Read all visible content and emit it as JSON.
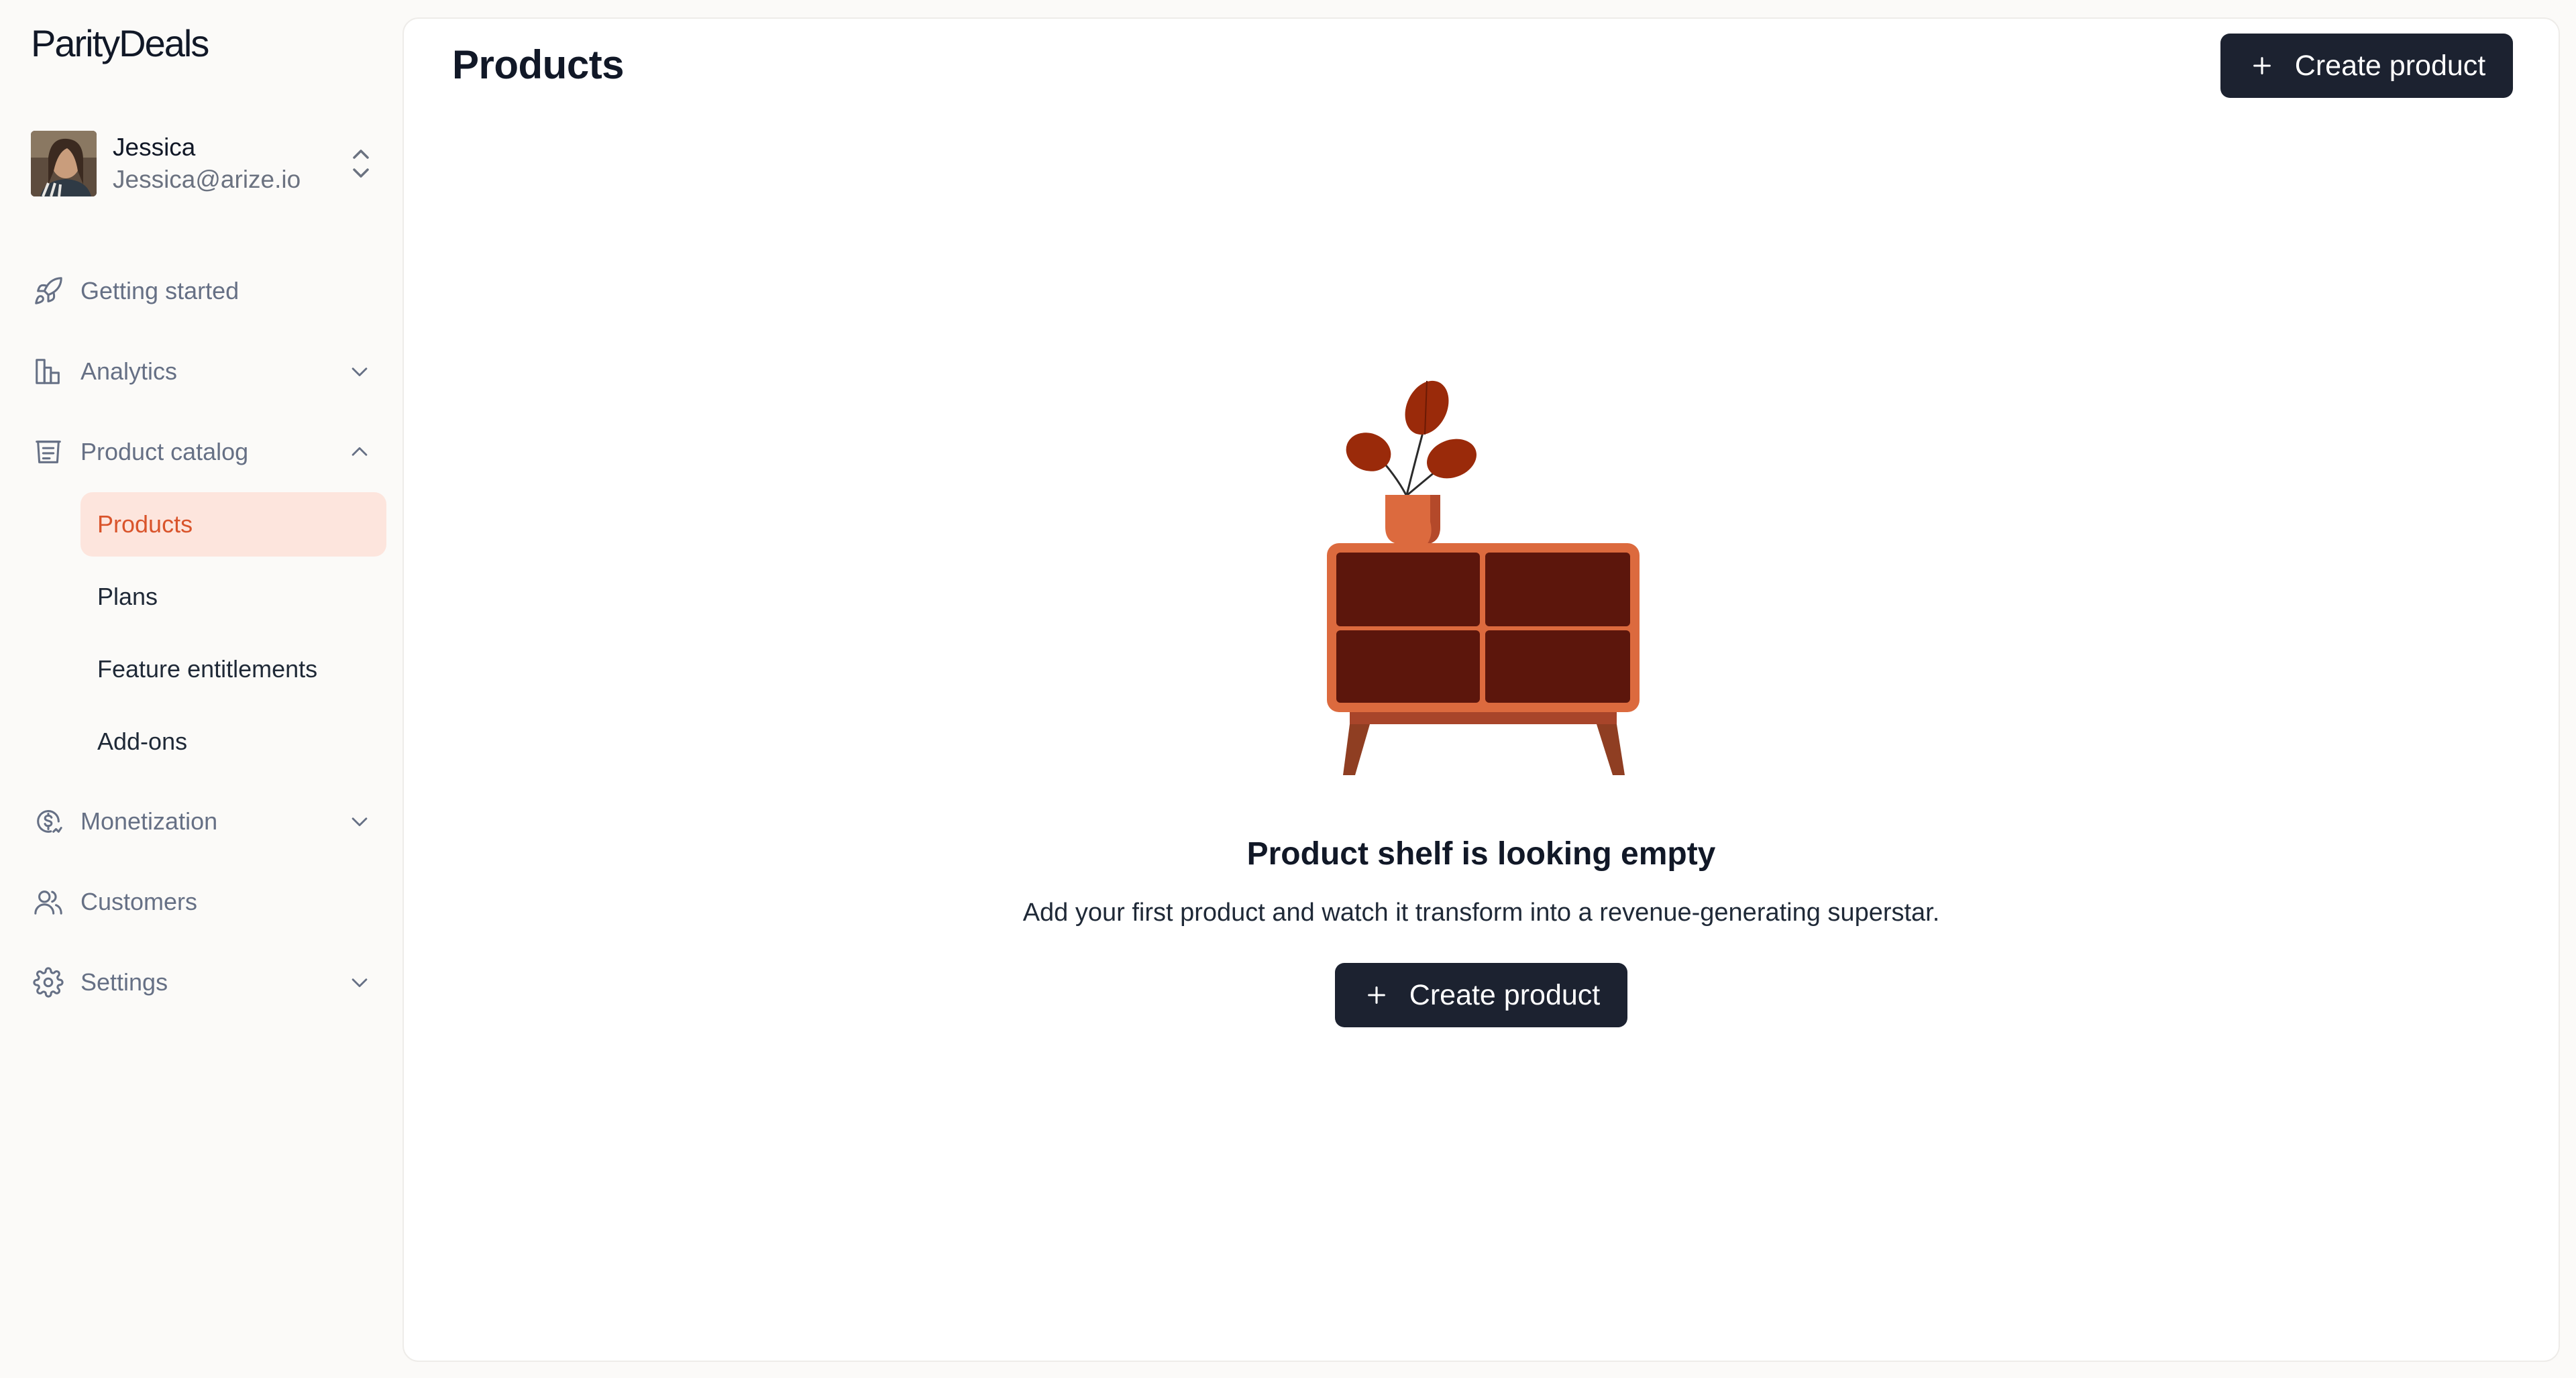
{
  "app": {
    "logo": "ParityDeals"
  },
  "user": {
    "name": "Jessica",
    "email": "Jessica@arize.io"
  },
  "sidebar": {
    "items": [
      {
        "label": "Getting started",
        "icon": "rocket-icon"
      },
      {
        "label": "Analytics",
        "icon": "bar-chart-icon",
        "expanded": false
      },
      {
        "label": "Product catalog",
        "icon": "catalog-icon",
        "expanded": true,
        "children": [
          {
            "label": "Products",
            "active": true
          },
          {
            "label": "Plans"
          },
          {
            "label": "Feature entitlements"
          },
          {
            "label": "Add-ons"
          }
        ]
      },
      {
        "label": "Monetization",
        "icon": "monetization-icon",
        "expanded": false
      },
      {
        "label": "Customers",
        "icon": "users-icon"
      },
      {
        "label": "Settings",
        "icon": "gear-icon",
        "expanded": false
      }
    ]
  },
  "main": {
    "title": "Products",
    "create_button_label": "Create product",
    "empty_state": {
      "title": "Product shelf is looking empty",
      "description": "Add your first product and watch it transform into a revenue-generating superstar.",
      "button_label": "Create product",
      "illustration": "cabinet-with-plant-illustration"
    }
  },
  "colors": {
    "accent": "#d9542b",
    "active_bg": "#fde5dd",
    "button_bg": "#1c2230",
    "cabinet_frame": "#dc6a3e",
    "cabinet_panel": "#5c160c"
  }
}
